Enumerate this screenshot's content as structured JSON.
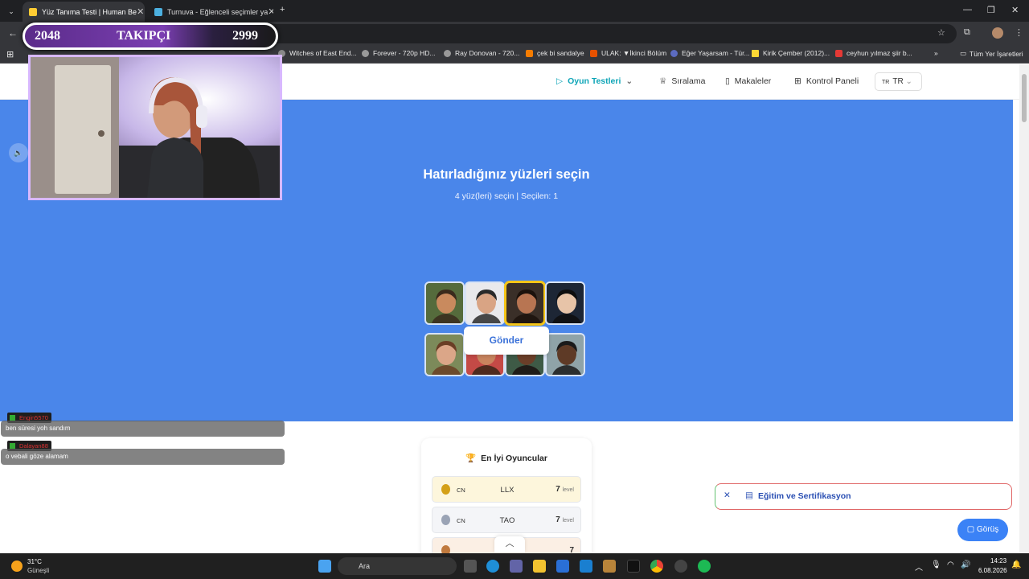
{
  "browser": {
    "tabs": [
      {
        "title": "Yüz Tanıma Testi | Human Be",
        "active": true
      },
      {
        "title": "Turnuva - Eğlenceli seçimler ya",
        "active": false
      }
    ],
    "url": "e-recognitio",
    "bookmarks": [
      "Witches of East End...",
      "Forever - 720p HD...",
      "Ray Donovan - 720...",
      "çek bi sandalye",
      "ULAK: ▼İkinci Bölüm",
      "Eğer Yaşarsam - Tür...",
      "Kirik Çember (2012)...",
      "ceyhun yılmaz şiir b...",
      "Tüm Yer İşaretleri"
    ]
  },
  "overlay": {
    "count_left": "2048",
    "label": "TAKIPÇI",
    "count_right": "2999"
  },
  "nav": {
    "games": "Oyun Testleri",
    "ranking": "Sıralama",
    "articles": "Makaleler",
    "dashboard": "Kontrol Paneli",
    "lang_code": "TR",
    "lang_flag": "TR"
  },
  "game": {
    "title": "Hatırladığınız yüzleri seçin",
    "subtitle": "4 yüz(leri) seçin | Seçilen: 1",
    "submit": "Gönder",
    "faces": [
      {
        "bg": "#556b3c",
        "skin": "#c98a5e",
        "hair": "#3a2a1c",
        "selected": false
      },
      {
        "bg": "#e9e9ec",
        "skin": "#d9a484",
        "hair": "#2a2a2a",
        "selected": false
      },
      {
        "bg": "#3a2f28",
        "skin": "#b87552",
        "hair": "#1c120c",
        "selected": true
      },
      {
        "bg": "#1d2635",
        "skin": "#e7c4a8",
        "hair": "#0e0e0e",
        "selected": false
      },
      {
        "bg": "#7c8a5a",
        "skin": "#dba688",
        "hair": "#6a3e25",
        "selected": false
      },
      {
        "bg": "#c44a46",
        "skin": "#c8845e",
        "hair": "#3a2418",
        "selected": false
      },
      {
        "bg": "#3e5a46",
        "skin": "#6a3e28",
        "hair": "#1a1210",
        "selected": false
      },
      {
        "bg": "#8fa3a8",
        "skin": "#5e3a26",
        "hair": "#1a1a1a",
        "selected": false
      }
    ]
  },
  "leaderboard": {
    "title": "En İyi Oyuncular",
    "rows": [
      {
        "country": "CN",
        "name": "LLX",
        "level": "7",
        "unit": "level",
        "medal": "#d4a017",
        "bg": "#fdf6dc"
      },
      {
        "country": "CN",
        "name": "TAO",
        "level": "7",
        "unit": "level",
        "medal": "#9aa3b5",
        "bg": "#f4f5f8"
      },
      {
        "country": "",
        "name": "",
        "level": "7",
        "unit": "",
        "medal": "#c07a3e",
        "bg": "#fbefe4"
      }
    ]
  },
  "cert": {
    "label": "Eğitim ve Sertifikasyon"
  },
  "chat_button": "Görüş",
  "chat": [
    {
      "user": "Engin5570",
      "text": "ben süresi yoh sandım"
    },
    {
      "user": "Dalayan88",
      "text": "o vebali göze alamam"
    }
  ],
  "taskbar": {
    "weather_temp": "31°C",
    "weather_desc": "Güneşli",
    "search": "Ara",
    "time": "14:23",
    "date": "6.08.2026"
  }
}
